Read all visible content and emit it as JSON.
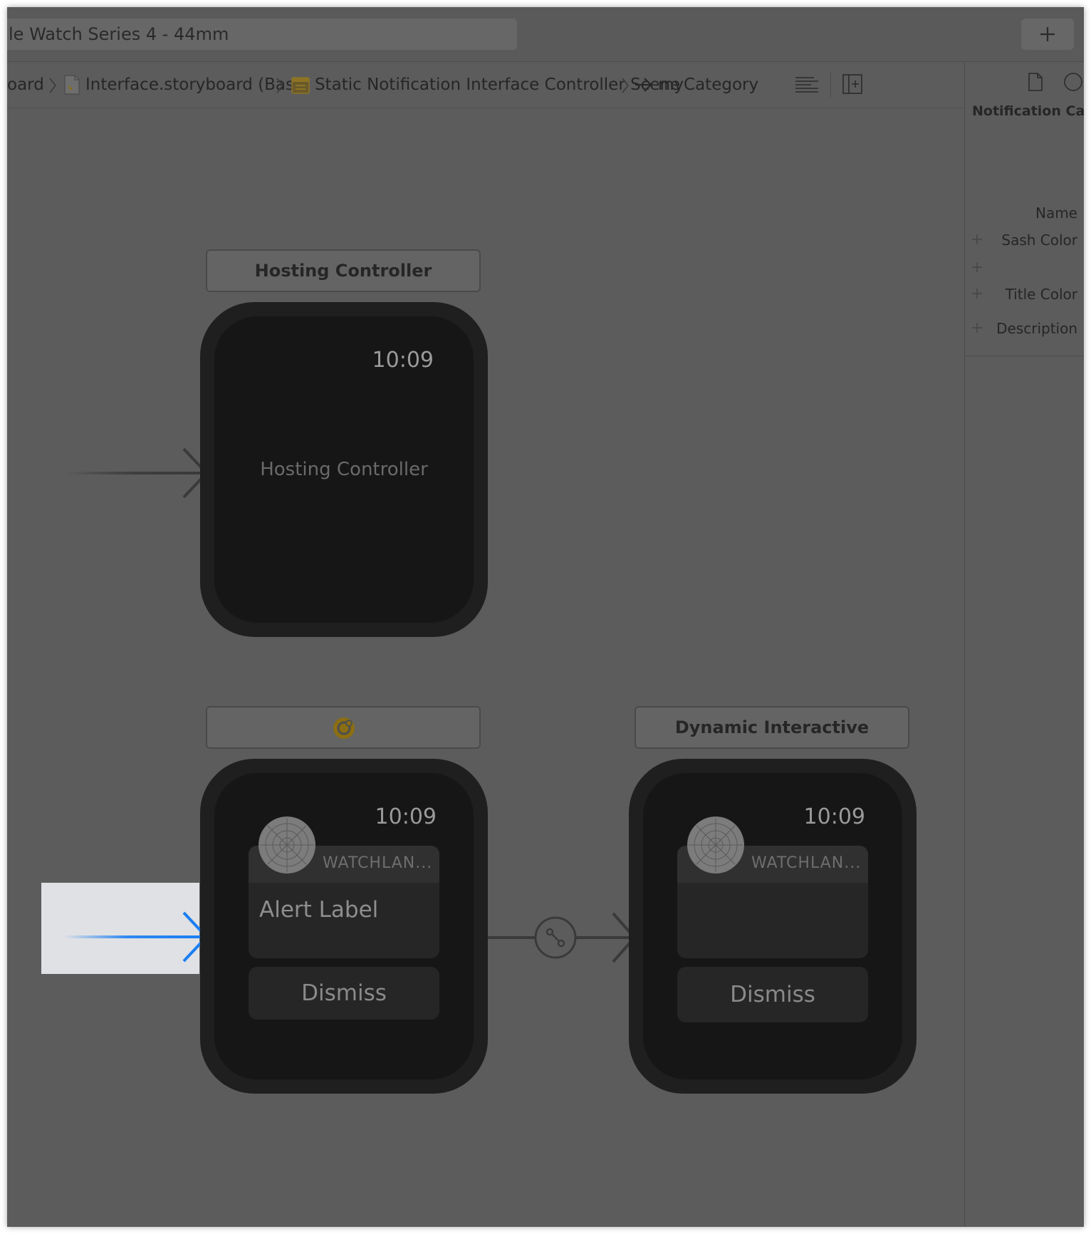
{
  "toolbar": {
    "device_label": "le Watch Series 4 - 44mm",
    "add_icon": "plus-icon"
  },
  "breadcrumb": {
    "items": [
      {
        "label": "oard"
      },
      {
        "label": "Interface.storyboard (Base)",
        "icon": "storyboard-file-icon"
      },
      {
        "label": "Static Notification Interface Controller Scene",
        "icon": "scene-icon"
      },
      {
        "label": "myCategory",
        "icon": "arrow-right-icon"
      }
    ],
    "right_icons": [
      "lines-icon",
      "add-editor-icon"
    ]
  },
  "inspector": {
    "tab_icons": [
      "file-icon",
      "help-icon"
    ],
    "section_title": "Notification Cat",
    "fields": [
      {
        "label": "Name"
      },
      {
        "label": "Sash Color"
      },
      {
        "label": ""
      },
      {
        "label": "Title Color"
      },
      {
        "label": "Description"
      }
    ]
  },
  "canvas": {
    "hosting": {
      "title": "Hosting Controller",
      "time": "10:09",
      "placeholder": "Hosting Controller"
    },
    "static_notification": {
      "title_icon": "notification-controller-icon",
      "time": "10:09",
      "app_name": "WATCHLAN...",
      "alert_label": "Alert Label",
      "dismiss": "Dismiss"
    },
    "dynamic_notification": {
      "title": "Dynamic Interactive Interface",
      "time": "10:09",
      "app_name": "WATCHLAN...",
      "dismiss": "Dismiss"
    },
    "segue_icon": "segue-link-icon",
    "colors": {
      "entry_arrow": "#1a7ef2",
      "highlight": "#dfe1e5",
      "background": "#5c5c5c"
    }
  }
}
